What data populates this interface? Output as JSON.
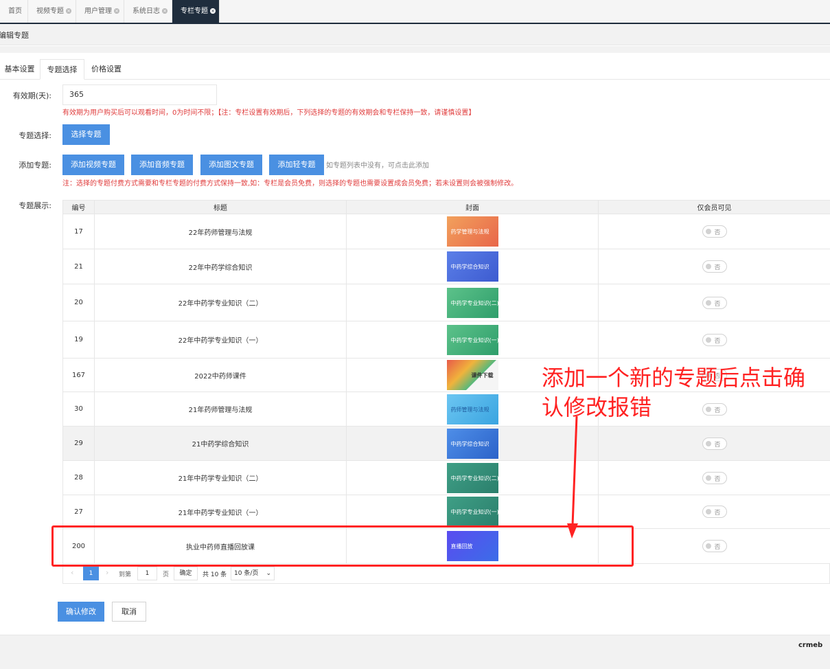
{
  "tabs": [
    {
      "label": "首页",
      "closable": false
    },
    {
      "label": "视频专题",
      "closable": true
    },
    {
      "label": "用户管理",
      "closable": true
    },
    {
      "label": "系统日志",
      "closable": true
    },
    {
      "label": "专栏专题",
      "closable": true,
      "active": true
    }
  ],
  "breadcrumb": "编辑专题",
  "subtabs": [
    "基本设置",
    "专题选择",
    "价格设置"
  ],
  "form": {
    "validity_label": "有效期(天):",
    "validity_value": "365",
    "validity_note": "有效期为用户购买后可以观看时间，0为时间不限；【注：专栏设置有效期后，下列选择的专题的有效期会和专栏保持一致，请谨慎设置】",
    "select_label": "专题选择:",
    "select_button": "选择专题",
    "add_label": "添加专题:",
    "add_buttons": [
      "添加视频专题",
      "添加音频专题",
      "添加图文专题",
      "添加轻专题"
    ],
    "add_hint": "如专题列表中没有，可点击此添加",
    "add_note": "注：选择的专题付费方式需要和专栏专题的付费方式保持一致,如：专栏是会员免费，则选择的专题也需要设置成会员免费；若未设置则会被强制修改。",
    "display_label": "专题展示:"
  },
  "table": {
    "headers": [
      "编号",
      "标题",
      "封面",
      "仅会员可见"
    ],
    "rows": [
      {
        "id": "17",
        "title": "22年药师管理与法规",
        "cover_text": "药学管理与法规",
        "toggle": "否"
      },
      {
        "id": "21",
        "title": "22年中药学综合知识",
        "cover_text": "中药学综合知识",
        "toggle": "否"
      },
      {
        "id": "20",
        "title": "22年中药学专业知识（二）",
        "cover_text": "中药学专业知识(二)",
        "toggle": "否"
      },
      {
        "id": "19",
        "title": "22年中药学专业知识（一）",
        "cover_text": "中药学专业知识(一)",
        "toggle": "否"
      },
      {
        "id": "167",
        "title": "2022中药师课件",
        "cover_text": "课件下载",
        "toggle": "否"
      },
      {
        "id": "30",
        "title": "21年药师管理与法规",
        "cover_text": "药师管理与法规",
        "toggle": "否"
      },
      {
        "id": "29",
        "title": "21中药学综合知识",
        "cover_text": "中药学综合知识",
        "toggle": "否"
      },
      {
        "id": "28",
        "title": "21年中药学专业知识（二）",
        "cover_text": "中药学专业知识(二)",
        "toggle": "否"
      },
      {
        "id": "27",
        "title": "21年中药学专业知识（一）",
        "cover_text": "中药学专业知识(一)",
        "toggle": "否"
      },
      {
        "id": "200",
        "title": "执业中药师直播回放课",
        "cover_text": "直播回放",
        "toggle": "否"
      }
    ]
  },
  "pager": {
    "current": "1",
    "goto_label": "到第",
    "goto_value": "1",
    "page_unit": "页",
    "confirm": "确定",
    "total": "共 10 条",
    "page_size": "10 条/页"
  },
  "actions": {
    "submit": "确认修改",
    "cancel": "取消"
  },
  "annotation": {
    "line1": "添加一个新的专题后点击确",
    "line2": "认修改报错"
  },
  "brand": "crmeb",
  "colors": {
    "primary": "#4a90e2",
    "annotation": "#ff2222",
    "note": "#e03c3c"
  }
}
